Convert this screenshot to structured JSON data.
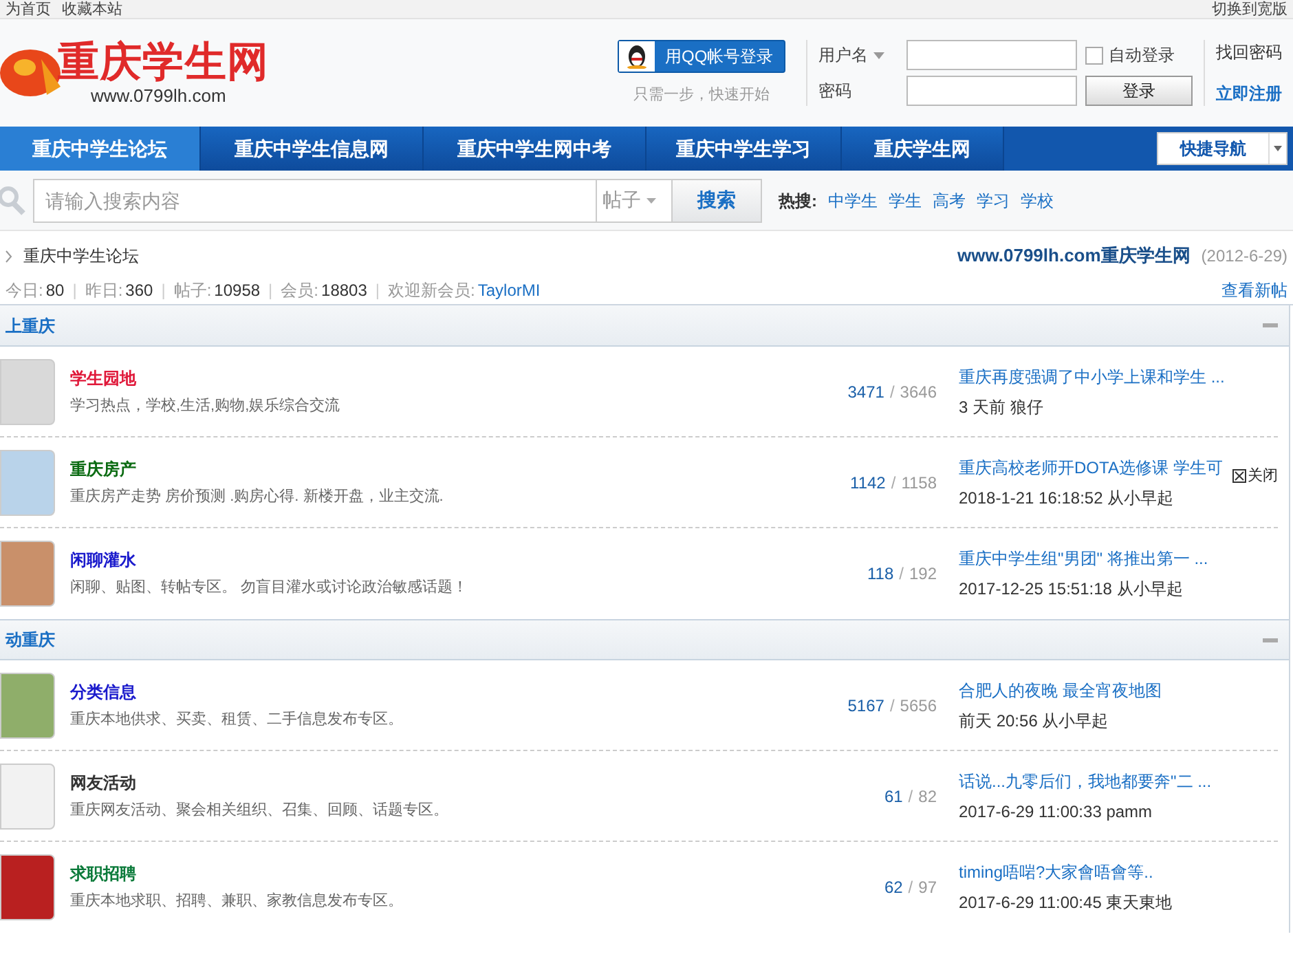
{
  "top_bar": {
    "links": [
      "为首页",
      "收藏本站"
    ],
    "right_link": "切换到宽版"
  },
  "logo": {
    "title": "重庆学生网",
    "url": "www.0799lh.com"
  },
  "qq_login": {
    "button": "用QQ帐号登录",
    "hint": "只需一步，快速开始"
  },
  "login": {
    "username_label": "用户名",
    "password_label": "密码",
    "auto_login": {
      "label": "自动登录",
      "checked": false
    },
    "submit": "登录",
    "forgot": "找回密码",
    "register": "立即注册"
  },
  "nav": {
    "items": [
      {
        "label": "重庆中学生论坛",
        "selected": true
      },
      {
        "label": "重庆中学生信息网",
        "selected": false
      },
      {
        "label": "重庆中学生网中考",
        "selected": false
      },
      {
        "label": "重庆中学生学习",
        "selected": false
      },
      {
        "label": "重庆学生网",
        "selected": false
      }
    ],
    "quick_nav": "快捷导航"
  },
  "search": {
    "placeholder": "请输入搜索内容",
    "scope": "帖子",
    "button": "搜索",
    "hot_label": "热搜:",
    "hot": [
      "中学生",
      "学生",
      "高考",
      "学习",
      "学校"
    ]
  },
  "breadcrumb": "重庆中学生论坛",
  "site_note": {
    "link": "www.0799lh.com重庆学生网",
    "date": "(2012-6-29)"
  },
  "stats": [
    {
      "label": "今日:",
      "value": "80",
      "separator": "|"
    },
    {
      "label": "昨日:",
      "value": "360",
      "separator": "|"
    },
    {
      "label": "帖子:",
      "value": "10958",
      "separator": "|"
    },
    {
      "label": "会员:",
      "value": "18803",
      "separator": "|"
    }
  ],
  "count_separator": "/",
  "new_member": {
    "label": "欢迎新会员:",
    "name": "TaylorMI"
  },
  "view_new": "查看新帖",
  "close_float": {
    "label": "关闭"
  },
  "sections": [
    {
      "title": "上重庆",
      "forums": [
        {
          "name": "学生园地",
          "color": "#e0193a",
          "desc": "学习热点，学校,生活,购物,娱乐综合交流",
          "threads": "3471",
          "posts": "3646",
          "last_title": "重庆再度强调了中小学上课和学生 ...",
          "last_meta": "3 天前 狼仔"
        },
        {
          "name": "重庆房产",
          "color": "#0b6b12",
          "desc": "重庆房产走势 房价预测 .购房心得. 新楼开盘，业主交流.",
          "threads": "1142",
          "posts": "1158",
          "last_title": "重庆高校老师开DOTA选修课 学生可",
          "last_meta": "2018-1-21 16:18:52 从小早起"
        },
        {
          "name": "闲聊灌水",
          "color": "#1a1acc",
          "desc": "闲聊、贴图、转帖专区。 勿盲目灌水或讨论政治敏感话题！",
          "threads": "118",
          "posts": "192",
          "last_title": "重庆中学生组\"男团\" 将推出第一 ...",
          "last_meta": "2017-12-25 15:51:18 从小早起"
        }
      ]
    },
    {
      "title": "动重庆",
      "forums": [
        {
          "name": "分类信息",
          "color": "#1a1acc",
          "desc": "重庆本地供求、买卖、租赁、二手信息发布专区。",
          "threads": "5167",
          "posts": "5656",
          "last_title": "合肥人的夜晚 最全宵夜地图",
          "last_meta": "前天 20:56 从小早起"
        },
        {
          "name": "网友活动",
          "color": "#333333",
          "desc": "重庆网友活动、聚会相关组织、召集、回顾、话题专区。",
          "threads": "61",
          "posts": "82",
          "last_title": "话说...九零后们，我地都要奔\"二 ...",
          "last_meta": "2017-6-29 11:00:33 pamm"
        },
        {
          "name": "求职招聘",
          "color": "#0b7a3a",
          "desc": "重庆本地求职、招聘、兼职、家教信息发布专区。",
          "threads": "62",
          "posts": "97",
          "last_title": "timing唔啱?大家會唔會等..",
          "last_meta": "2017-6-29 11:00:45 東天東地"
        }
      ]
    }
  ]
}
